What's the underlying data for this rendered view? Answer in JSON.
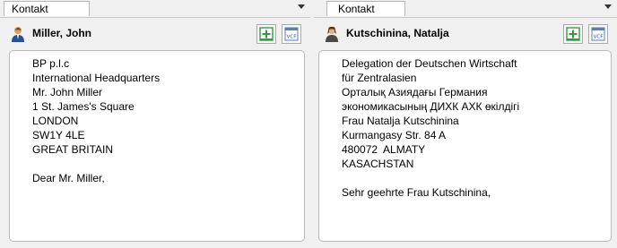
{
  "left": {
    "tab_label": "Kontakt",
    "contact_name": "Miller, John",
    "icons": {
      "contact": "person-icon",
      "add": "add-to-document-icon",
      "vcf": "vcf-card-icon"
    },
    "vcf_label": "VCF",
    "address_lines": [
      "BP p.l.c",
      "International Headquarters",
      "Mr. John Miller",
      "1 St. James's Square",
      "LONDON",
      "SW1Y 4LE",
      "GREAT BRITAIN",
      "",
      "Dear Mr. Miller,"
    ]
  },
  "right": {
    "tab_label": "Kontakt",
    "contact_name": "Kutschinina, Natalja",
    "icons": {
      "contact": "person-icon",
      "add": "add-to-document-icon",
      "vcf": "vcf-card-icon"
    },
    "vcf_label": "VCF",
    "address_lines": [
      "Delegation der Deutschen Wirtschaft",
      "für Zentralasien",
      "Орталық Азиядағы Германия",
      "экономикасының ДИХК АХК өкілдігі",
      "Frau Natalja Kutschinina",
      "Kurmangasy Str. 84 A",
      "480072  ALMATY",
      "KASACHSTAN",
      "",
      "Sehr geehrte Frau Kutschinina,"
    ]
  },
  "colors": {
    "add_green": "#2e9e3e",
    "border": "#b9b9b9",
    "background": "#f0f0f0"
  }
}
